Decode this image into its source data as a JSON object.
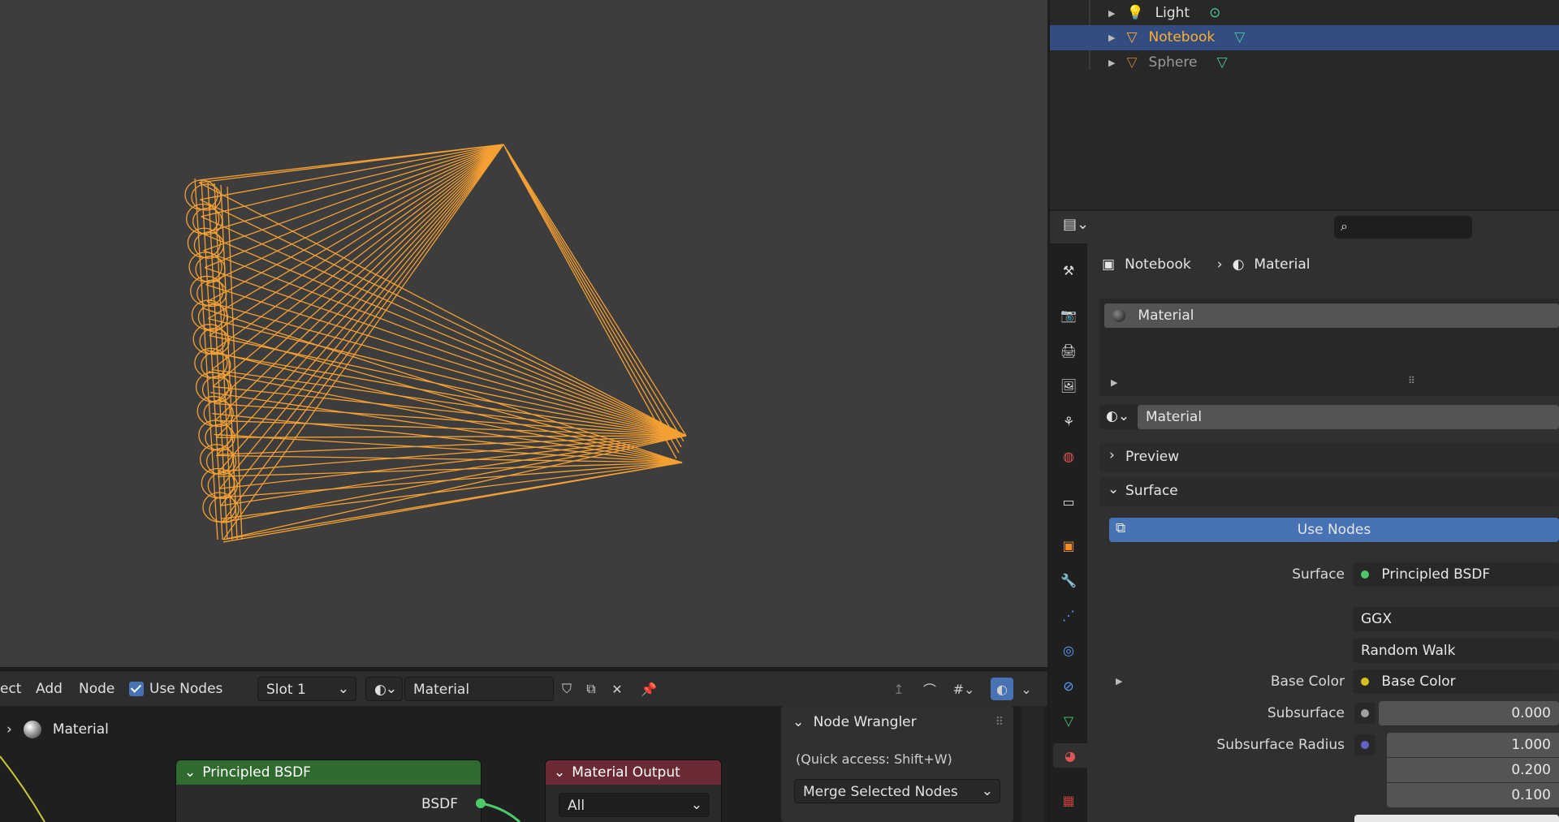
{
  "outliner": {
    "items": [
      {
        "label": "Light",
        "color": "#e0e0e0"
      },
      {
        "label": "Notebook",
        "color": "#ffaf29"
      },
      {
        "label": "Sphere",
        "color": "#9a9a9a"
      }
    ]
  },
  "properties": {
    "search_placeholder": "",
    "breadcrumb": {
      "object": "Notebook",
      "material": "Material"
    },
    "slot_list_item": "Material",
    "material_name": "Material",
    "preview_label": "Preview",
    "surface_label": "Surface",
    "use_nodes_label": "Use Nodes",
    "surface_field_label": "Surface",
    "surface_value": "Principled BSDF",
    "distribution": "GGX",
    "subsurface_method": "Random Walk",
    "base_color_label": "Base Color",
    "base_color_value": "Base Color",
    "subsurface_label": "Subsurface",
    "subsurface_value": "0.000",
    "subsurface_radius_label": "Subsurface Radius",
    "subsurface_radius_values": [
      "1.000",
      "0.200",
      "0.100"
    ]
  },
  "node_editor": {
    "menu": [
      "ect",
      "Add",
      "Node"
    ],
    "use_nodes_label": "Use Nodes",
    "slot": "Slot 1",
    "material": "Material",
    "breadcrumb": "Material",
    "nodes": {
      "principled": {
        "title": "Principled BSDF",
        "output": "BSDF",
        "color": "#2f6b2f"
      },
      "output": {
        "title": "Material Output",
        "target": "All",
        "color": "#6b2a33"
      }
    }
  },
  "node_wrangler": {
    "title": "Node Wrangler",
    "hint": "(Quick access: Shift+W)",
    "action": "Merge Selected Nodes"
  },
  "colors": {
    "selection": "#334d80",
    "accent_blue": "#4772b3",
    "wire_orange": "#f5a033"
  }
}
